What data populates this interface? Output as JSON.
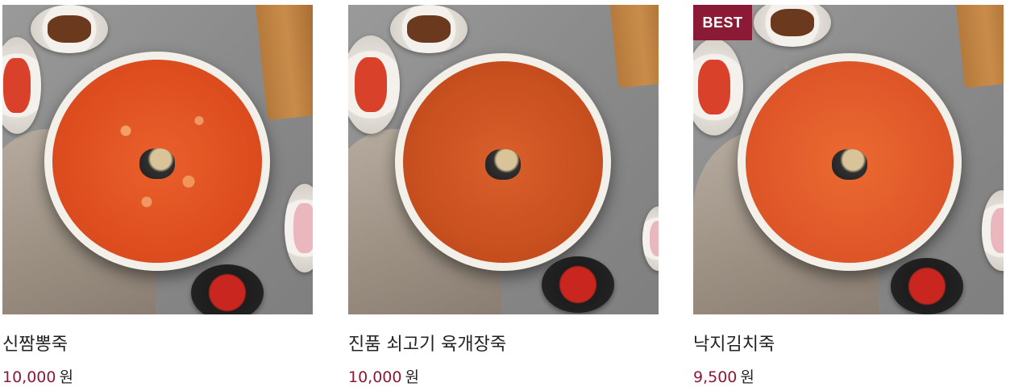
{
  "products": [
    {
      "name": "신짬뽕죽",
      "price": "10,000",
      "currency": "원",
      "badge": "",
      "photo_icon": "seafood-porridge-photo"
    },
    {
      "name": "진품 쇠고기 육개장죽",
      "price": "10,000",
      "currency": "원",
      "badge": "",
      "photo_icon": "beef-yukgaejang-porridge-photo"
    },
    {
      "name": "낙지김치죽",
      "price": "9,500",
      "currency": "원",
      "badge": "BEST",
      "photo_icon": "octopus-kimchi-porridge-photo"
    }
  ],
  "colors": {
    "accent": "#8a1a35",
    "text": "#222222",
    "background": "#ffffff"
  }
}
